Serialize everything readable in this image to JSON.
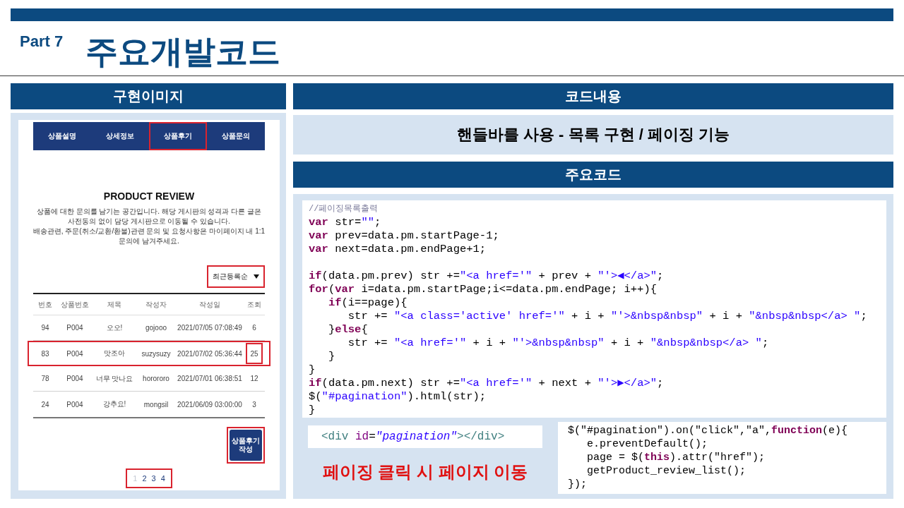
{
  "header": {
    "part": "Part 7",
    "title": "주요개발코드"
  },
  "left": {
    "heading": "구현이미지",
    "shot": {
      "tabs": [
        {
          "label": "상품설명",
          "outlined": false
        },
        {
          "label": "상세정보",
          "outlined": false
        },
        {
          "label": "상품후기",
          "outlined": true
        },
        {
          "label": "상품문의",
          "outlined": false
        }
      ],
      "heading": "PRODUCT REVIEW",
      "notes": [
        "상품에 대한 문의를 남기는 공간입니다. 해당 게시판의 성격과 다른 글은 사전동의 없이 담당 게시판으로 이동될 수 있습니다.",
        "배송관련, 주문(취소/교환/환불)관련 문의 및 요청사항은 마이페이지 내 1:1 문의에 남겨주세요."
      ],
      "sort": {
        "value": "최근등록순",
        "outlined": true
      },
      "table": {
        "columns": [
          "번호",
          "상품번호",
          "제목",
          "작성자",
          "작성일",
          "조회"
        ],
        "rows": [
          {
            "cells": [
              "94",
              "P004",
              "오오!",
              "gojooo",
              "2021/07/05 07:08:49",
              "6"
            ],
            "outlined": false,
            "views_outlined": false
          },
          {
            "cells": [
              "83",
              "P004",
              "맛조아",
              "suzysuzy",
              "2021/07/02 05:36:44",
              "25"
            ],
            "outlined": true,
            "views_outlined": true
          },
          {
            "cells": [
              "78",
              "P004",
              "너무 맛나요",
              "horororo",
              "2021/07/01 06:38:51",
              "12"
            ],
            "outlined": false,
            "views_outlined": false
          },
          {
            "cells": [
              "24",
              "P004",
              "강추요!",
              "mongsil",
              "2021/06/09 03:00:00",
              "3"
            ],
            "outlined": false,
            "views_outlined": false
          }
        ]
      },
      "write_button": {
        "label": "상품후기작성",
        "outlined": true
      },
      "pagination": {
        "outlined": true,
        "pages": [
          {
            "label": "1",
            "selected": true
          },
          {
            "label": "2",
            "selected": false
          },
          {
            "label": "3",
            "selected": false
          },
          {
            "label": "4",
            "selected": false
          }
        ]
      }
    }
  },
  "right": {
    "heading": "코드내용",
    "summary": "핸들바를 사용 - 목록 구현 / 페이징 기능",
    "code_heading": "주요코드",
    "code_blocks": [
      [
        [
          {
            "kind": "comment",
            "text": "//페이징목록출력"
          }
        ],
        [
          {
            "kind": "keyword",
            "text": "var"
          },
          {
            "kind": "plain",
            "text": " str="
          },
          {
            "kind": "string",
            "text": "\"\""
          },
          {
            "kind": "plain",
            "text": ";"
          }
        ],
        [
          {
            "kind": "keyword",
            "text": "var"
          },
          {
            "kind": "plain",
            "text": " prev=data.pm.startPage-1;"
          }
        ],
        [
          {
            "kind": "keyword",
            "text": "var"
          },
          {
            "kind": "plain",
            "text": " next=data.pm.endPage+1;"
          }
        ]
      ],
      [
        [
          {
            "kind": "keyword",
            "text": "if"
          },
          {
            "kind": "plain",
            "text": "(data.pm.prev) str +="
          },
          {
            "kind": "string",
            "text": "\"<a href='\""
          },
          {
            "kind": "plain",
            "text": " + prev + "
          },
          {
            "kind": "string",
            "text": "\"'>◀</a>\""
          },
          {
            "kind": "plain",
            "text": ";"
          }
        ],
        [
          {
            "kind": "keyword",
            "text": "for"
          },
          {
            "kind": "plain",
            "text": "("
          },
          {
            "kind": "keyword",
            "text": "var"
          },
          {
            "kind": "plain",
            "text": " i=data.pm.startPage;i<=data.pm.endPage; i++){"
          }
        ],
        [
          {
            "kind": "keyword",
            "text": "   if"
          },
          {
            "kind": "plain",
            "text": "(i==page){"
          }
        ],
        [
          {
            "kind": "plain",
            "text": "      str += "
          },
          {
            "kind": "string",
            "text": "\"<a class='active' href='\""
          },
          {
            "kind": "plain",
            "text": " + i + "
          },
          {
            "kind": "string",
            "text": "\"'>&nbsp&nbsp\""
          },
          {
            "kind": "plain",
            "text": " + i + "
          },
          {
            "kind": "string",
            "text": "\"&nbsp&nbsp</a> \""
          },
          {
            "kind": "plain",
            "text": ";"
          }
        ],
        [
          {
            "kind": "plain",
            "text": "   }"
          },
          {
            "kind": "keyword",
            "text": "else"
          },
          {
            "kind": "plain",
            "text": "{"
          }
        ],
        [
          {
            "kind": "plain",
            "text": "      str += "
          },
          {
            "kind": "string",
            "text": "\"<a href='\""
          },
          {
            "kind": "plain",
            "text": " + i + "
          },
          {
            "kind": "string",
            "text": "\"'>&nbsp&nbsp\""
          },
          {
            "kind": "plain",
            "text": " + i + "
          },
          {
            "kind": "string",
            "text": "\"&nbsp&nbsp</a> \""
          },
          {
            "kind": "plain",
            "text": ";"
          }
        ],
        [
          {
            "kind": "plain",
            "text": "   }"
          }
        ],
        [
          {
            "kind": "plain",
            "text": "}"
          }
        ],
        [
          {
            "kind": "keyword",
            "text": "if"
          },
          {
            "kind": "plain",
            "text": "(data.pm.next) str +="
          },
          {
            "kind": "string",
            "text": "\"<a href='\""
          },
          {
            "kind": "plain",
            "text": " + next + "
          },
          {
            "kind": "string",
            "text": "\"'>▶</a>\""
          },
          {
            "kind": "plain",
            "text": ";"
          }
        ],
        [
          {
            "kind": "plain",
            "text": "$("
          },
          {
            "kind": "string",
            "text": "\"#pagination\""
          },
          {
            "kind": "plain",
            "text": ").html(str);"
          }
        ],
        [
          {
            "kind": "plain",
            "text": "}"
          }
        ]
      ]
    ],
    "markup": [
      {
        "kind": "tag",
        "text": "<div "
      },
      {
        "kind": "attr",
        "text": "id"
      },
      {
        "kind": "plain",
        "text": "="
      },
      {
        "kind": "value",
        "text": "\"pagination\""
      },
      {
        "kind": "tag",
        "text": "></div>"
      }
    ],
    "note": "페이징 클릭 시 페이지 이동",
    "handler_code": [
      [
        {
          "kind": "plain",
          "text": "$(\"#pagination\").on(\"click\",\"a\","
        },
        {
          "kind": "keyword",
          "text": "function"
        },
        {
          "kind": "plain",
          "text": "(e){"
        }
      ],
      [
        {
          "kind": "plain",
          "text": "   e.preventDefault();"
        }
      ],
      [
        {
          "kind": "plain",
          "text": "   page = $("
        },
        {
          "kind": "keyword",
          "text": "this"
        },
        {
          "kind": "plain",
          "text": ").attr(\"href\");"
        }
      ],
      [
        {
          "kind": "plain",
          "text": "   getProduct_review_list();"
        }
      ],
      [
        {
          "kind": "plain",
          "text": "});"
        }
      ]
    ]
  }
}
